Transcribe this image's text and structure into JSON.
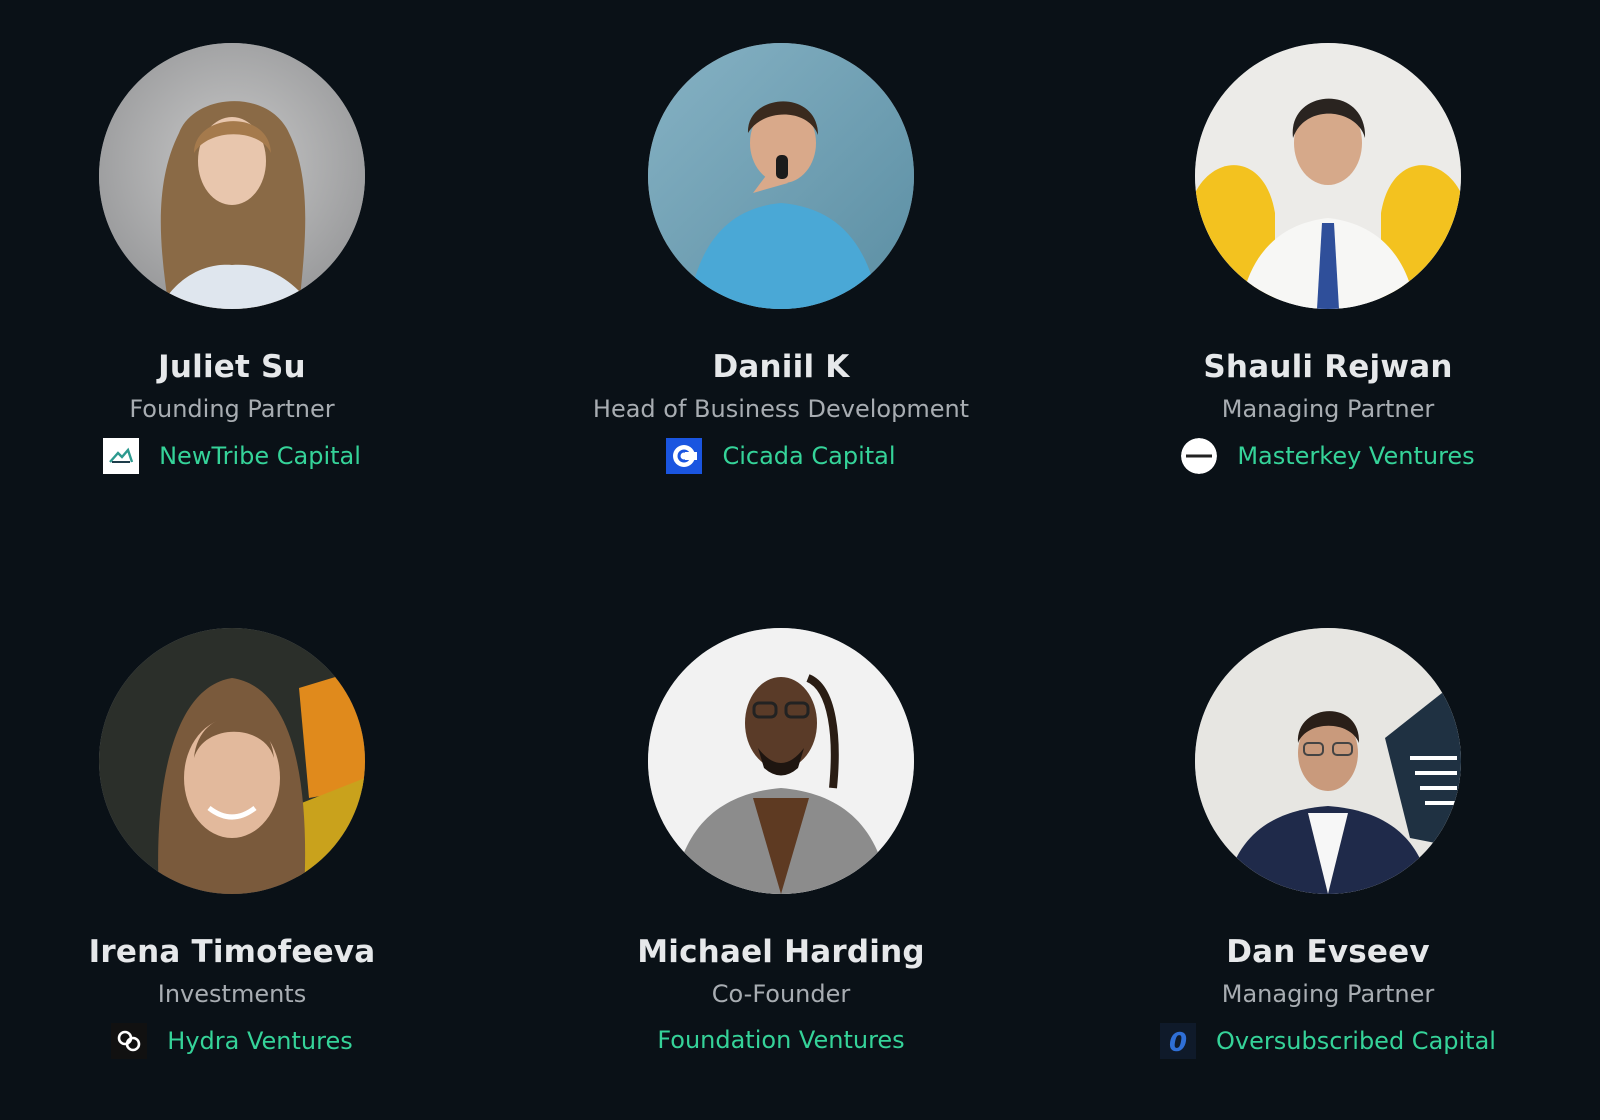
{
  "people": [
    {
      "name": "Juliet Su",
      "role": "Founding Partner",
      "company": "NewTribe Capital",
      "logo_icon": "newtribe-logo-icon",
      "photo_bg": "#9a9b9d",
      "accent": "#2d9a8f"
    },
    {
      "name": "Daniil K",
      "role": "Head of Business Development",
      "company": "Cicada Capital",
      "logo_icon": "cicada-logo-icon",
      "photo_bg": "#6f9fb4",
      "accent": "#1a55e0"
    },
    {
      "name": "Shauli Rejwan",
      "role": "Managing Partner",
      "company": "Masterkey Ventures",
      "logo_icon": "masterkey-logo-icon",
      "photo_bg": "#e9e9e6",
      "accent": "#f5c21c"
    },
    {
      "name": "Irena Timofeeva",
      "role": "Investments",
      "company": "Hydra Ventures",
      "logo_icon": "hydra-logo-icon",
      "photo_bg": "#2b2f2a",
      "accent": "#e08a1c"
    },
    {
      "name": "Michael Harding",
      "role": "Co-Founder",
      "company": "Foundation Ventures",
      "logo_icon": "",
      "photo_bg": "#f2f2f2",
      "accent": "#8a8a8a"
    },
    {
      "name": "Dan Evseev",
      "role": "Managing Partner",
      "company": "Oversubscribed Capital",
      "logo_icon": "oversubscribed-logo-icon",
      "photo_bg": "#e7e6e2",
      "accent": "#2f6fd6",
      "logo_letter": "0"
    }
  ],
  "colors": {
    "background": "#0a1117",
    "name": "#e6e8ea",
    "role": "#a8adb2",
    "company_link": "#35d399"
  }
}
